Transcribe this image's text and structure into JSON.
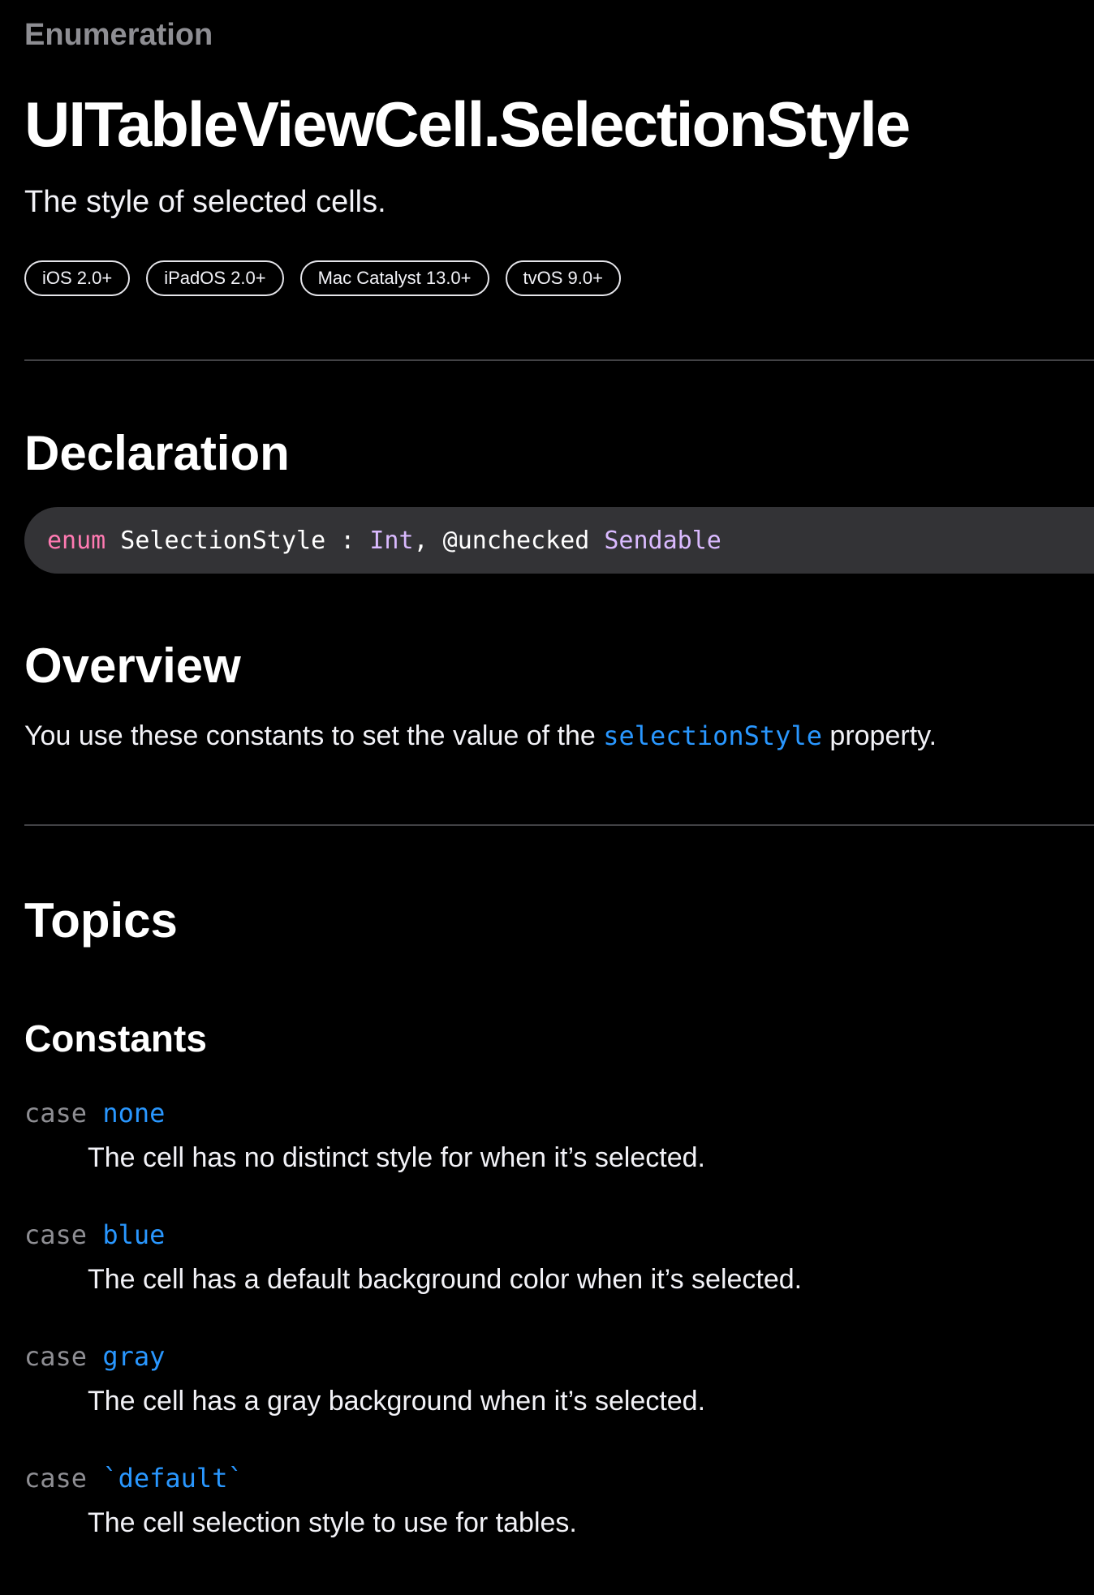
{
  "header": {
    "eyebrow": "Enumeration",
    "title": "UITableViewCell.SelectionStyle",
    "abstract": "The style of selected cells.",
    "availability": [
      "iOS 2.0+",
      "iPadOS 2.0+",
      "Mac Catalyst 13.0+",
      "tvOS 9.0+"
    ]
  },
  "declaration": {
    "heading": "Declaration",
    "keyword": "enum",
    "name": " SelectionStyle : ",
    "type1": "Int",
    "sep": ", @unchecked ",
    "type2": "Sendable"
  },
  "overview": {
    "heading": "Overview",
    "text_before": "You use these constants to set the value of the ",
    "link": "selectionStyle",
    "text_after": " property."
  },
  "topics": {
    "heading": "Topics",
    "group_heading": "Constants",
    "constants": [
      {
        "keyword": "case",
        "name": "none",
        "description": "The cell has no distinct style for when it’s selected."
      },
      {
        "keyword": "case",
        "name": "blue",
        "description": "The cell has a default background color when it’s selected."
      },
      {
        "keyword": "case",
        "name": "gray",
        "description": "The cell has a gray background when it’s selected."
      },
      {
        "keyword": "case",
        "name": "`default`",
        "description": "The cell selection style to use for tables."
      }
    ]
  },
  "colors": {
    "background": "#000000",
    "link": "#2997ff",
    "code_keyword": "#ff7ab2",
    "code_type": "#dabaff",
    "code_background": "#333336"
  }
}
